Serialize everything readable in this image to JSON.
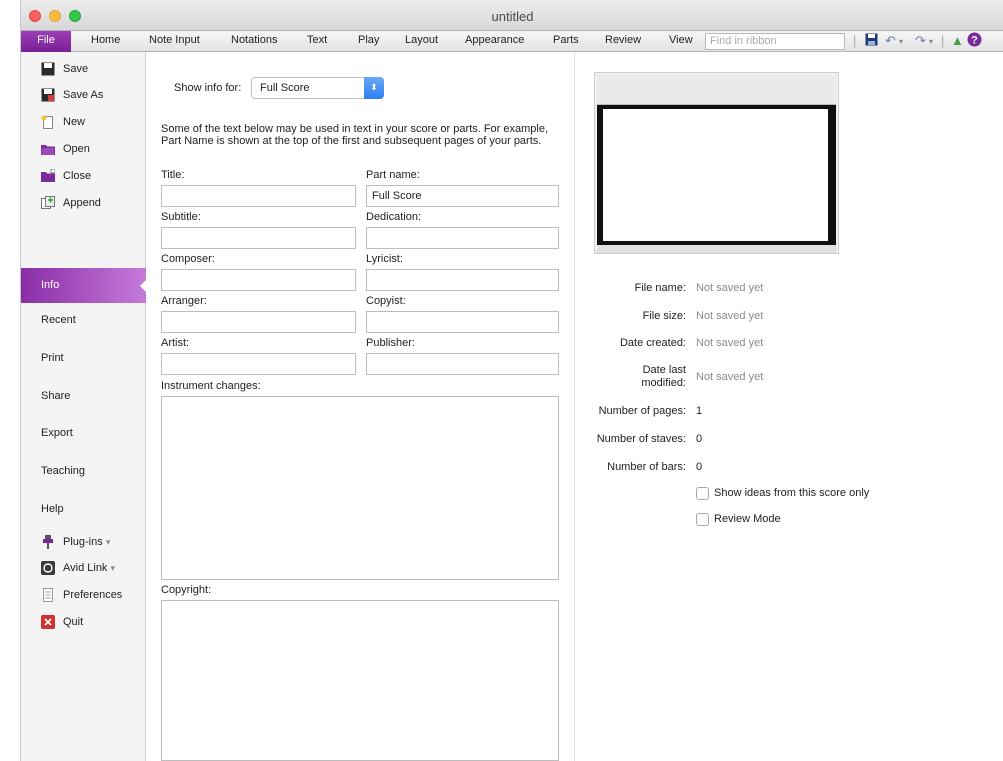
{
  "window": {
    "title": "untitled"
  },
  "ribbon": {
    "tabs": [
      "File",
      "Home",
      "Note Input",
      "Notations",
      "Text",
      "Play",
      "Layout",
      "Appearance",
      "Parts",
      "Review",
      "View"
    ],
    "search_placeholder": "Find in ribbon"
  },
  "nav": {
    "file_items": [
      {
        "label": "Save",
        "icon": "save-icon"
      },
      {
        "label": "Save As",
        "icon": "save-as-icon"
      },
      {
        "label": "New",
        "icon": "new-icon"
      },
      {
        "label": "Open",
        "icon": "open-folder-icon"
      },
      {
        "label": "Close",
        "icon": "close-folder-icon"
      },
      {
        "label": "Append",
        "icon": "append-icon"
      }
    ],
    "active": "Info",
    "sections": [
      "Recent",
      "Print",
      "Share",
      "Export",
      "Teaching",
      "Help"
    ],
    "tool_items": [
      {
        "label": "Plug-ins",
        "icon": "plugin-icon",
        "has_menu": true
      },
      {
        "label": "Avid Link",
        "icon": "avid-link-icon",
        "has_menu": true
      },
      {
        "label": "Preferences",
        "icon": "preferences-icon",
        "has_menu": false
      },
      {
        "label": "Quit",
        "icon": "quit-icon",
        "has_menu": false
      }
    ],
    "menu_caret": "▾"
  },
  "form": {
    "show_info_label": "Show info for:",
    "show_info_value": "Full Score",
    "description": "Some of the text below may be used in text in your score or parts. For example, Part Name is shown at the top of the first and subsequent pages of your parts.",
    "fields": {
      "title": {
        "label": "Title:",
        "value": ""
      },
      "part_name": {
        "label": "Part name:",
        "value": "Full Score"
      },
      "subtitle": {
        "label": "Subtitle:",
        "value": ""
      },
      "dedication": {
        "label": "Dedication:",
        "value": ""
      },
      "composer": {
        "label": "Composer:",
        "value": ""
      },
      "lyricist": {
        "label": "Lyricist:",
        "value": ""
      },
      "arranger": {
        "label": "Arranger:",
        "value": ""
      },
      "copyist": {
        "label": "Copyist:",
        "value": ""
      },
      "artist": {
        "label": "Artist:",
        "value": ""
      },
      "publisher": {
        "label": "Publisher:",
        "value": ""
      },
      "instrument_changes": {
        "label": "Instrument changes:",
        "value": ""
      },
      "copyright": {
        "label": "Copyright:",
        "value": ""
      }
    }
  },
  "info": {
    "file_name": {
      "label": "File name:",
      "value": "Not saved yet"
    },
    "file_size": {
      "label": "File size:",
      "value": "Not saved yet"
    },
    "date_created": {
      "label": "Date created:",
      "value": "Not saved yet"
    },
    "date_modified": {
      "label_line1": "Date last",
      "label_line2": "modified:",
      "value": "Not saved yet"
    },
    "pages": {
      "label": "Number of pages:",
      "value": "1"
    },
    "staves": {
      "label": "Number of staves:",
      "value": "0"
    },
    "bars": {
      "label": "Number of bars:",
      "value": "0"
    },
    "show_ideas": {
      "label": "Show ideas from this score only",
      "checked": false
    },
    "review_mode": {
      "label": "Review Mode",
      "checked": false
    }
  }
}
